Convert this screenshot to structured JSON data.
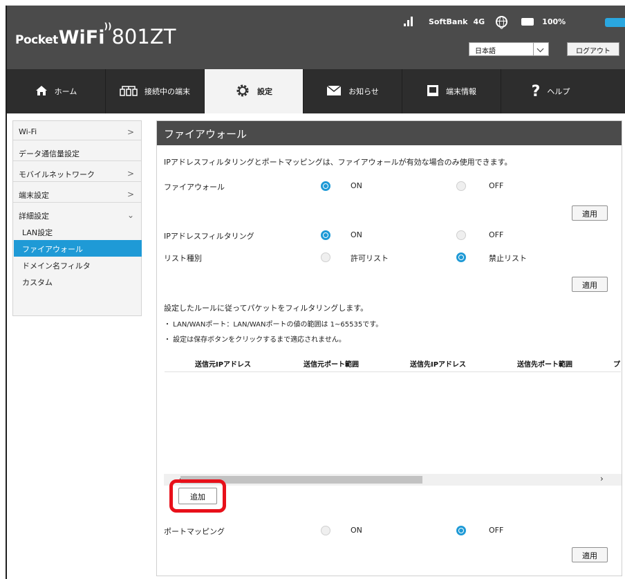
{
  "header": {
    "brand_pocket": "Pocket",
    "brand_wifi": "WiFi",
    "brand_model": "801ZT",
    "carrier": "SoftBank",
    "network_type": "4G",
    "battery": "100%",
    "language": "日本語",
    "logout": "ログアウト"
  },
  "nav": {
    "home": "ホーム",
    "devices": "接続中の端末",
    "settings": "設定",
    "notices": "お知らせ",
    "device_info": "端末情報",
    "help": "ヘルプ"
  },
  "sidebar": {
    "wifi": "Wi-Fi",
    "data_usage": "データ通信量設定",
    "mobile_network": "モバイルネットワーク",
    "device_settings": "端末設定",
    "advanced": "詳細設定",
    "lan": "LAN設定",
    "firewall": "ファイアウォール",
    "domain_filter": "ドメイン名フィルタ",
    "custom": "カスタム"
  },
  "main": {
    "title": "ファイアウォール",
    "note": "IPアドレスフィルタリングとポートマッピングは、ファイアウォールが有効な場合のみ使用できます。",
    "firewall_label": "ファイアウォール",
    "on": "ON",
    "off": "OFF",
    "apply": "適用",
    "ip_filter_label": "IPアドレスフィルタリング",
    "list_type_label": "リスト種別",
    "allow_list": "許可リスト",
    "deny_list": "禁止リスト",
    "rule_desc": "設定したルールに従ってパケットをフィルタリングします。",
    "bullet1": "・ LAN/WANポート：LAN/WANポートの値の範囲は 1~65535です。",
    "bullet2": "・ 設定は保存ボタンをクリックするまで適応されません。",
    "table_headers": [
      "送信元IPアドレス",
      "送信元ポート範囲",
      "送信先IPアドレス",
      "送信先ポート範囲",
      "プ"
    ],
    "add": "追加",
    "port_mapping_label": "ポートマッピング"
  },
  "state": {
    "firewall": "ON",
    "ip_filter": "ON",
    "list_type": "禁止リスト",
    "port_mapping": "OFF"
  },
  "colors": {
    "accent": "#1f9ad6",
    "header_bg": "#4b4b4b",
    "nav_bg": "#2d2d2d",
    "highlight": "#e8101a",
    "battery": "#2aa7e0"
  }
}
